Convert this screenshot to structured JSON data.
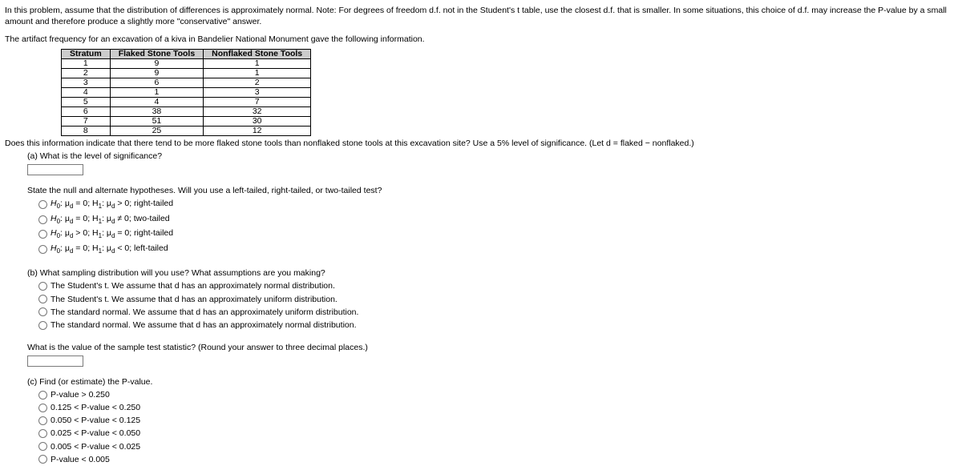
{
  "intro": "In this problem, assume that the distribution of differences is approximately normal. Note: For degrees of freedom d.f. not in the Student's t table, use the closest d.f. that is smaller. In some situations, this choice of d.f. may increase the P-value by a small amount and therefore produce a slightly more \"conservative\" answer.",
  "artifact_line": "The artifact frequency for an excavation of a kiva in Bandelier National Monument gave the following information.",
  "table": {
    "headers": [
      "Stratum",
      "Flaked Stone Tools",
      "Nonflaked Stone Tools"
    ],
    "rows": [
      [
        "1",
        "9",
        "1"
      ],
      [
        "2",
        "9",
        "1"
      ],
      [
        "3",
        "6",
        "2"
      ],
      [
        "4",
        "1",
        "3"
      ],
      [
        "5",
        "4",
        "7"
      ],
      [
        "6",
        "38",
        "32"
      ],
      [
        "7",
        "51",
        "30"
      ],
      [
        "8",
        "25",
        "12"
      ]
    ]
  },
  "question_line": "Does this information indicate that there tend to be more flaked stone tools than nonflaked stone tools at this excavation site? Use a 5% level of significance. (Let d = flaked − nonflaked.)",
  "part_a_label": "(a) What is the level of significance?",
  "hypotheses_prompt": "State the null and alternate hypotheses. Will you use a left-tailed, right-tailed, or two-tailed test?",
  "hyp_options": [
    {
      "prefix": "H",
      "sub0": "0",
      "mid1": ": μ",
      "subd1": "d",
      "eq": " = 0; H",
      "sub1": "1",
      "mid2": ": μ",
      "subd2": "d",
      "rel": " > 0; right-tailed"
    },
    {
      "prefix": "H",
      "sub0": "0",
      "mid1": ": μ",
      "subd1": "d",
      "eq": " = 0; H",
      "sub1": "1",
      "mid2": ": μ",
      "subd2": "d",
      "rel": " ≠ 0; two-tailed"
    },
    {
      "prefix": "H",
      "sub0": "0",
      "mid1": ": μ",
      "subd1": "d",
      "eq": " > 0; H",
      "sub1": "1",
      "mid2": ": μ",
      "subd2": "d",
      "rel": " = 0; right-tailed"
    },
    {
      "prefix": "H",
      "sub0": "0",
      "mid1": ": μ",
      "subd1": "d",
      "eq": " = 0; H",
      "sub1": "1",
      "mid2": ": μ",
      "subd2": "d",
      "rel": " < 0; left-tailed"
    }
  ],
  "part_b_label": "(b) What sampling distribution will you use? What assumptions are you making?",
  "dist_options": [
    "The Student's t. We assume that d has an approximately normal distribution.",
    "The Student's t. We assume that d has an approximately uniform distribution.",
    "The standard normal. We assume that d has an approximately uniform distribution.",
    "The standard normal. We assume that d has an approximately normal distribution."
  ],
  "test_stat_prompt": "What is the value of the sample test statistic? (Round your answer to three decimal places.)",
  "part_c_label": "(c) Find (or estimate) the P-value.",
  "pvalue_options": [
    "P-value > 0.250",
    "0.125 < P-value < 0.250",
    "0.050 < P-value < 0.125",
    "0.025 < P-value < 0.050",
    "0.005 < P-value < 0.025",
    "P-value < 0.005"
  ]
}
